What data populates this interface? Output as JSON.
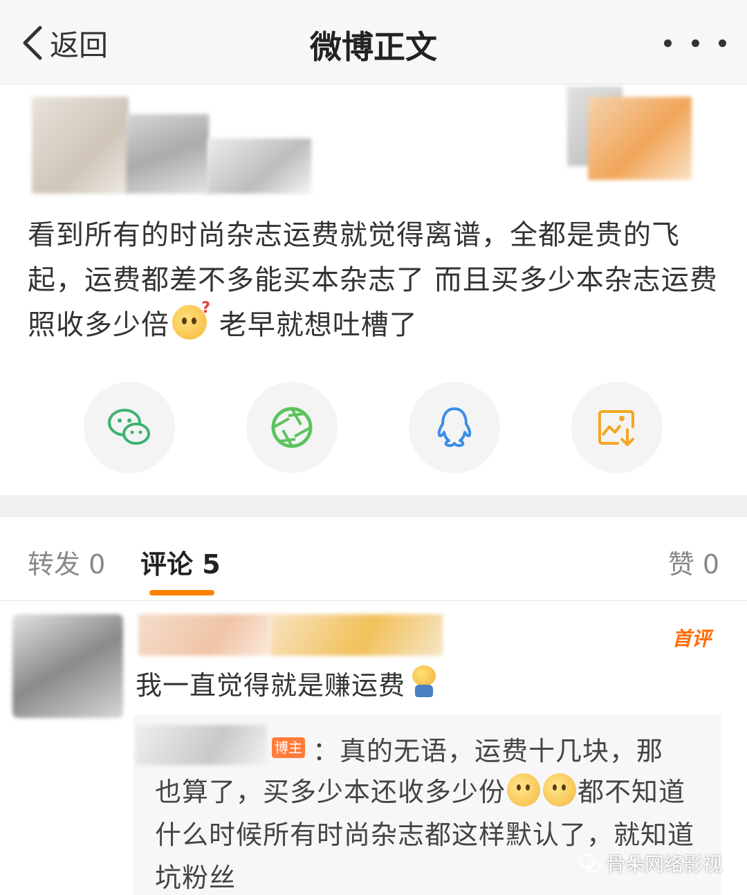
{
  "navbar": {
    "back_label": "返回",
    "title": "微博正文"
  },
  "post": {
    "text_before_emoji": "看到所有的时尚杂志运费就觉得离谱，全都是贵的飞起，运费都差不多能买本杂志了 而且买多少本杂志运费照收多少倍",
    "emoji": "thinking-question-emoji",
    "text_after_emoji": " 老早就想吐槽了"
  },
  "share": [
    {
      "name": "wechat-icon",
      "color": "#3cb371"
    },
    {
      "name": "moments-icon",
      "color": "#5cc45e"
    },
    {
      "name": "qq-icon",
      "color": "#3a8ee6"
    },
    {
      "name": "save-image-icon",
      "color": "#f5a623"
    }
  ],
  "tabs": {
    "repost": "转发 0",
    "comment": "评论 5",
    "like": "赞 0",
    "active_color": "#ff8200"
  },
  "comment": {
    "badge": "首评",
    "text": "我一直觉得就是赚运费",
    "reply": {
      "badge": "博主",
      "line1": "：真的无语，运费十几块，那",
      "line2_before": "也算了，买多少本还收多少份",
      "line2_after": "都不",
      "rest": "知道什么时候所有时尚杂志都这样默认了，就知道坑粉丝"
    }
  },
  "watermark": "骨朵网络影视"
}
